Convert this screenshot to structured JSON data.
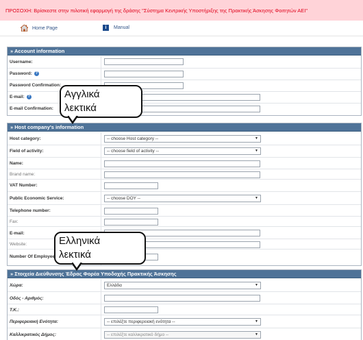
{
  "banner": {
    "text": "ΠΡΟΣΟΧΗ: Βρίσκεστε στην πιλοτική εφαρμογή της δράσης \"Σύστημα Κεντρικής Υποστήριξης της Πρακτικής Άσκησης Φοιτητών ΑΕΙ\""
  },
  "nav": {
    "home": "Home Page",
    "manual": "Manual"
  },
  "account": {
    "title": "» Account information",
    "username": "Username:",
    "password": "Password:",
    "password_confirm": "Password Confirmation:",
    "email": "E-mail:",
    "email_confirm": "E-mail Confirmation:"
  },
  "host": {
    "title": "» Host company's information",
    "category": "Host category:",
    "category_value": "-- choose Host category --",
    "field": "Field of activity:",
    "field_value": "-- choose field of activity --",
    "name": "Name:",
    "brand": "Brand name:",
    "vat": "VAT Number:",
    "pes": "Public Economic Service:",
    "pes_value": "-- choose DOY --",
    "phone": "Telephone number:",
    "fax": "Fax:",
    "email": "E-mail:",
    "website": "Website:",
    "employees": "Number Of Employees:"
  },
  "address": {
    "title": "» Στοιχεία Διεύθυνσης Έδρας Φορέα Υποδοχής Πρακτικής Άσκησης",
    "country": "Χώρα:",
    "country_value": "Ελλάδα",
    "street": "Οδός - Αριθμός:",
    "zip": "Τ.Κ.:",
    "region": "Περιφερειακή Ενότητα:",
    "region_value": "-- επιλέξτε περιφερειακή ενότητα --",
    "municipality": "Καλλικρατικός Δήμος:",
    "municipality_value": "-- επιλέξτε καλλικρατικό δήμο --"
  },
  "callouts": {
    "english_line1": "Αγγλικά",
    "english_line2": "λεκτικά",
    "greek_line1": "Ελληνικά",
    "greek_line2": "λεκτικά"
  },
  "icons": {
    "home": "home-icon",
    "manual": "info-icon",
    "help": "help-icon",
    "dropdown": "chevron-down-icon"
  },
  "colors": {
    "banner_bg": "#ffd3d8",
    "banner_text": "#e0001a",
    "section_header": "#4f7398"
  }
}
